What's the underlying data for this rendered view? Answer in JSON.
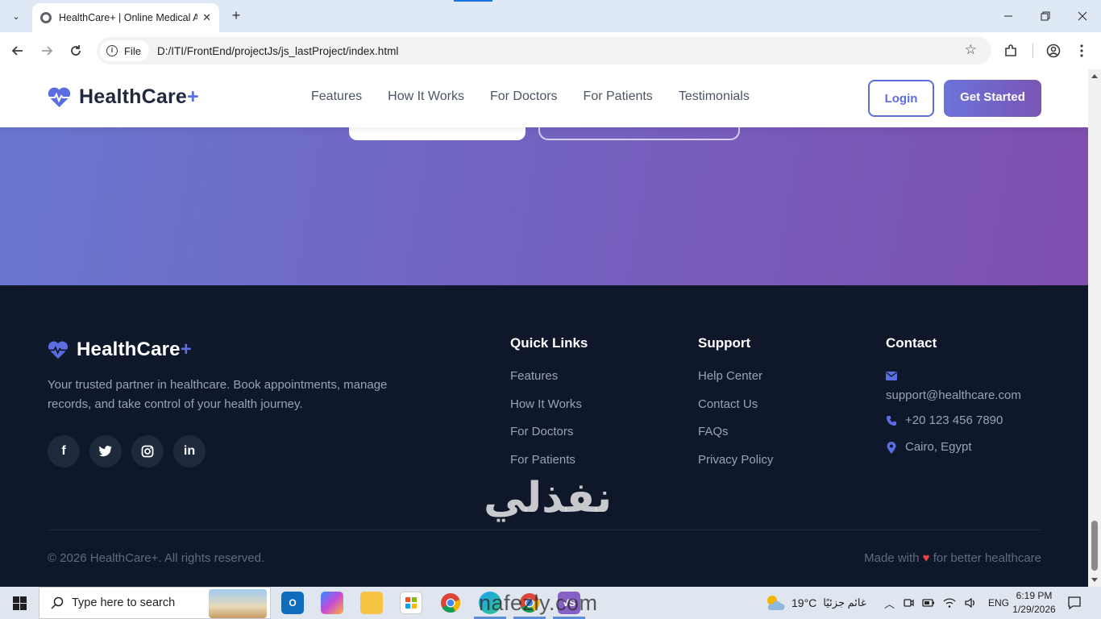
{
  "browser": {
    "tab_title": "HealthCare+ | Online Medical A",
    "tab_close": "✕",
    "new_tab": "+",
    "menu_glyph": "⌄",
    "url_chip": "File",
    "url": "D:/ITI/FrontEnd/projectJs/js_lastProject/index.html",
    "icons": [
      "back-icon",
      "forward-icon",
      "reload-icon",
      "info-icon",
      "star-icon",
      "extensions-icon",
      "profile-icon",
      "more-icon"
    ],
    "window_controls": [
      "minimize",
      "restore",
      "close"
    ]
  },
  "site": {
    "brand": "HealthCare",
    "brand_plus": "+",
    "nav": [
      "Features",
      "How It Works",
      "For Doctors",
      "For Patients",
      "Testimonials"
    ],
    "login": "Login",
    "get_started": "Get Started",
    "accent_color": "#5b6ee1"
  },
  "footer": {
    "brand": "HealthCare",
    "brand_plus": "+",
    "description": "Your trusted partner in healthcare. Book appointments, manage records, and take control of your health journey.",
    "socials": [
      "facebook-icon",
      "twitter-icon",
      "instagram-icon",
      "linkedin-icon"
    ],
    "quick_links": {
      "title": "Quick Links",
      "items": [
        "Features",
        "How It Works",
        "For Doctors",
        "For Patients"
      ]
    },
    "support": {
      "title": "Support",
      "items": [
        "Help Center",
        "Contact Us",
        "FAQs",
        "Privacy Policy"
      ]
    },
    "contact": {
      "title": "Contact",
      "email": "support@healthcare.com",
      "phone": "+20 123 456 7890",
      "location": "Cairo, Egypt"
    },
    "copyright": "© 2026 HealthCare+. All rights reserved.",
    "made_with_prefix": "Made with",
    "made_with_heart": "♥",
    "made_with_suffix": "for better healthcare"
  },
  "watermark": {
    "arabic": "نفذلي",
    "latin": "nafezly.com"
  },
  "taskbar": {
    "search_placeholder": "Type here to search",
    "apps": [
      "outlook-icon",
      "copilot-icon",
      "file-explorer-icon",
      "store-icon",
      "chrome-icon",
      "edge-icon",
      "chrome-profile-icon",
      "visual-studio-icon"
    ],
    "weather_temp": "19°C",
    "weather_text": "غائم جزئيًا",
    "language": "ENG",
    "time": "6:19 PM",
    "date": "1/29/2026"
  }
}
